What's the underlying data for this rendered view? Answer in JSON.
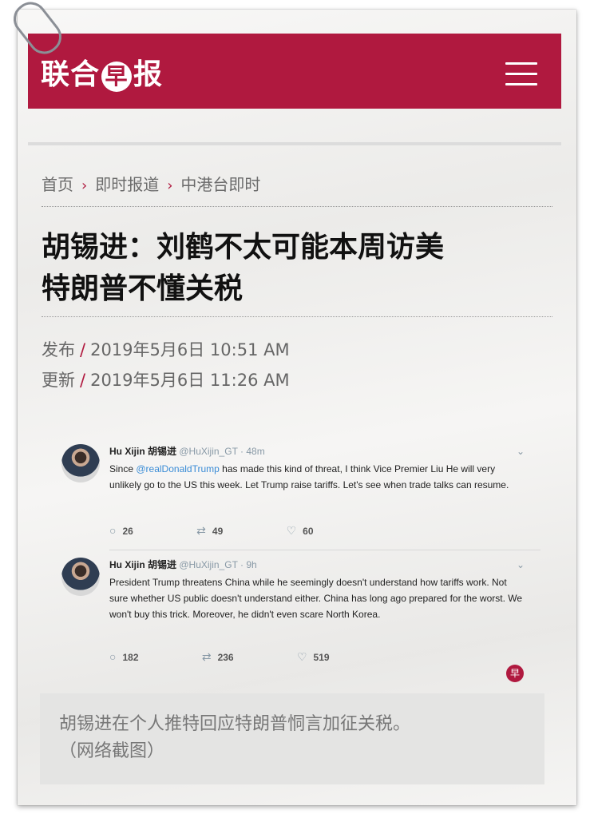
{
  "header": {
    "logo_text_1": "联合",
    "logo_badge": "早",
    "logo_text_2": "报"
  },
  "breadcrumb": {
    "items": [
      "首页",
      "即时报道",
      "中港台即时"
    ],
    "separator": "›"
  },
  "article": {
    "title_line1": "胡锡进：刘鹤不太可能本周访美",
    "title_line2": "特朗普不懂关税",
    "published_label": "发布",
    "published_value": "2019年5月6日 10:51 AM",
    "updated_label": "更新",
    "updated_value": "2019年5月6日 11:26 AM",
    "meta_separator": "/"
  },
  "tweets": [
    {
      "name": "Hu Xijin 胡锡进",
      "handle": "@HuXijin_GT · 48m",
      "text_prefix": "Since ",
      "mention": "@realDonaldTrump",
      "text_rest": " has made this kind of threat, I think Vice Premier Liu He will very unlikely go to the US this week. Let Trump raise tariffs. Let's see when trade talks can resume.",
      "replies": "26",
      "retweets": "49",
      "likes": "60"
    },
    {
      "name": "Hu Xijin 胡锡进",
      "handle": "@HuXijin_GT · 9h",
      "text": "President Trump threatens China while he seemingly doesn't understand how tariffs work. Not sure whether US public doesn't understand either. China has long ago prepared for the worst. We won't buy this trick. Moreover, he didn't even scare North Korea.",
      "replies": "182",
      "retweets": "236",
      "likes": "519"
    }
  ],
  "watermark": "早",
  "caption": {
    "line1": "胡锡进在个人推特回应特朗普恫言加征关税。",
    "line2": "（网络截图）"
  },
  "icons": {
    "reply": "reply-icon",
    "retweet": "retweet-icon",
    "like": "heart-icon",
    "menu": "hamburger-menu-icon",
    "chevron": "chevron-down-icon"
  },
  "colors": {
    "brand": "#b0193f",
    "mention": "#3a8cd6",
    "paper": "#f1f0ee"
  }
}
